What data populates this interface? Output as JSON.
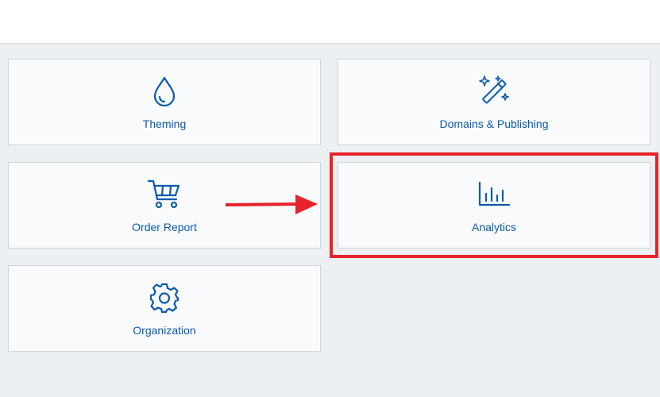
{
  "tiles": {
    "theming": {
      "label": "Theming",
      "icon": "droplet-icon"
    },
    "domains": {
      "label": "Domains & Publishing",
      "icon": "magic-wand-icon"
    },
    "order_report": {
      "label": "Order Report",
      "icon": "shopping-cart-icon"
    },
    "analytics": {
      "label": "Analytics",
      "icon": "bar-chart-icon"
    },
    "organization": {
      "label": "Organization",
      "icon": "gear-icon"
    }
  },
  "colors": {
    "accent": "#0b5cab",
    "annotation": "#e8232a",
    "background": "#edf0f3",
    "tile": "#f9fafb"
  }
}
